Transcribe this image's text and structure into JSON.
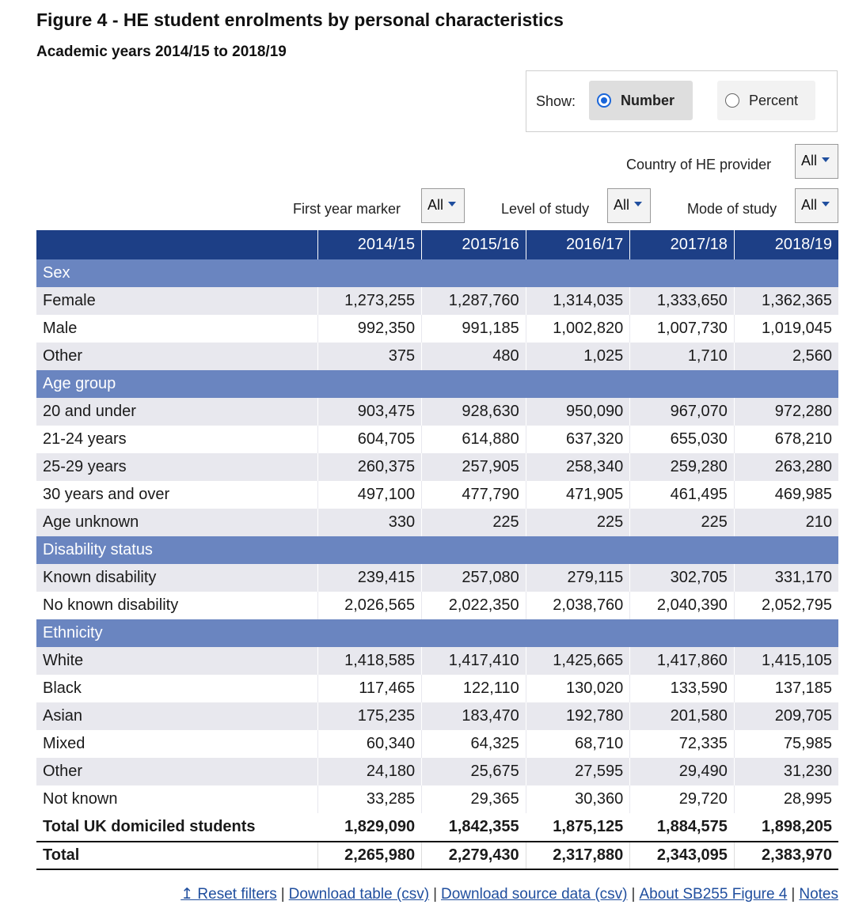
{
  "title": "Figure 4 - HE student enrolments by personal characteristics",
  "subtitle": "Academic years 2014/15 to 2018/19",
  "show": {
    "label": "Show:",
    "options": [
      {
        "label": "Number",
        "selected": true
      },
      {
        "label": "Percent",
        "selected": false
      }
    ]
  },
  "filters": {
    "country": {
      "label": "Country of HE provider",
      "value": "All"
    },
    "first_year": {
      "label": "First year marker",
      "value": "All"
    },
    "level": {
      "label": "Level of study",
      "value": "All"
    },
    "mode": {
      "label": "Mode of study",
      "value": "All"
    }
  },
  "table": {
    "header": [
      "",
      "2014/15",
      "2015/16",
      "2016/17",
      "2017/18",
      "2018/19"
    ],
    "sections": [
      {
        "name": "Sex",
        "rows": [
          {
            "label": "Female",
            "values": [
              "1,273,255",
              "1,287,760",
              "1,314,035",
              "1,333,650",
              "1,362,365"
            ]
          },
          {
            "label": "Male",
            "values": [
              "992,350",
              "991,185",
              "1,002,820",
              "1,007,730",
              "1,019,045"
            ]
          },
          {
            "label": "Other",
            "values": [
              "375",
              "480",
              "1,025",
              "1,710",
              "2,560"
            ]
          }
        ]
      },
      {
        "name": "Age group",
        "rows": [
          {
            "label": "20 and under",
            "values": [
              "903,475",
              "928,630",
              "950,090",
              "967,070",
              "972,280"
            ]
          },
          {
            "label": "21-24 years",
            "values": [
              "604,705",
              "614,880",
              "637,320",
              "655,030",
              "678,210"
            ]
          },
          {
            "label": "25-29 years",
            "values": [
              "260,375",
              "257,905",
              "258,340",
              "259,280",
              "263,280"
            ]
          },
          {
            "label": "30 years and over",
            "values": [
              "497,100",
              "477,790",
              "471,905",
              "461,495",
              "469,985"
            ]
          },
          {
            "label": "Age unknown",
            "values": [
              "330",
              "225",
              "225",
              "225",
              "210"
            ]
          }
        ]
      },
      {
        "name": "Disability status",
        "rows": [
          {
            "label": "Known disability",
            "values": [
              "239,415",
              "257,080",
              "279,115",
              "302,705",
              "331,170"
            ]
          },
          {
            "label": "No known disability",
            "values": [
              "2,026,565",
              "2,022,350",
              "2,038,760",
              "2,040,390",
              "2,052,795"
            ]
          }
        ]
      },
      {
        "name": "Ethnicity",
        "rows": [
          {
            "label": "White",
            "values": [
              "1,418,585",
              "1,417,410",
              "1,425,665",
              "1,417,860",
              "1,415,105"
            ]
          },
          {
            "label": "Black",
            "values": [
              "117,465",
              "122,110",
              "130,020",
              "133,590",
              "137,185"
            ]
          },
          {
            "label": "Asian",
            "values": [
              "175,235",
              "183,470",
              "192,780",
              "201,580",
              "209,705"
            ]
          },
          {
            "label": "Mixed",
            "values": [
              "60,340",
              "64,325",
              "68,710",
              "72,335",
              "75,985"
            ]
          },
          {
            "label": "Other",
            "values": [
              "24,180",
              "25,675",
              "27,595",
              "29,490",
              "31,230"
            ]
          },
          {
            "label": "Not known",
            "values": [
              "33,285",
              "29,365",
              "30,360",
              "29,720",
              "28,995"
            ]
          }
        ]
      }
    ],
    "subtotal": {
      "label": "Total UK domiciled students",
      "values": [
        "1,829,090",
        "1,842,355",
        "1,875,125",
        "1,884,575",
        "1,898,205"
      ]
    },
    "total": {
      "label": "Total",
      "values": [
        "2,265,980",
        "2,279,430",
        "2,317,880",
        "2,343,095",
        "2,383,970"
      ]
    }
  },
  "footer": {
    "links": [
      "↥ Reset filters",
      "Download table (csv)",
      "Download source data (csv)",
      "About SB255 Figure 4",
      "Notes"
    ],
    "separator": "|"
  }
}
